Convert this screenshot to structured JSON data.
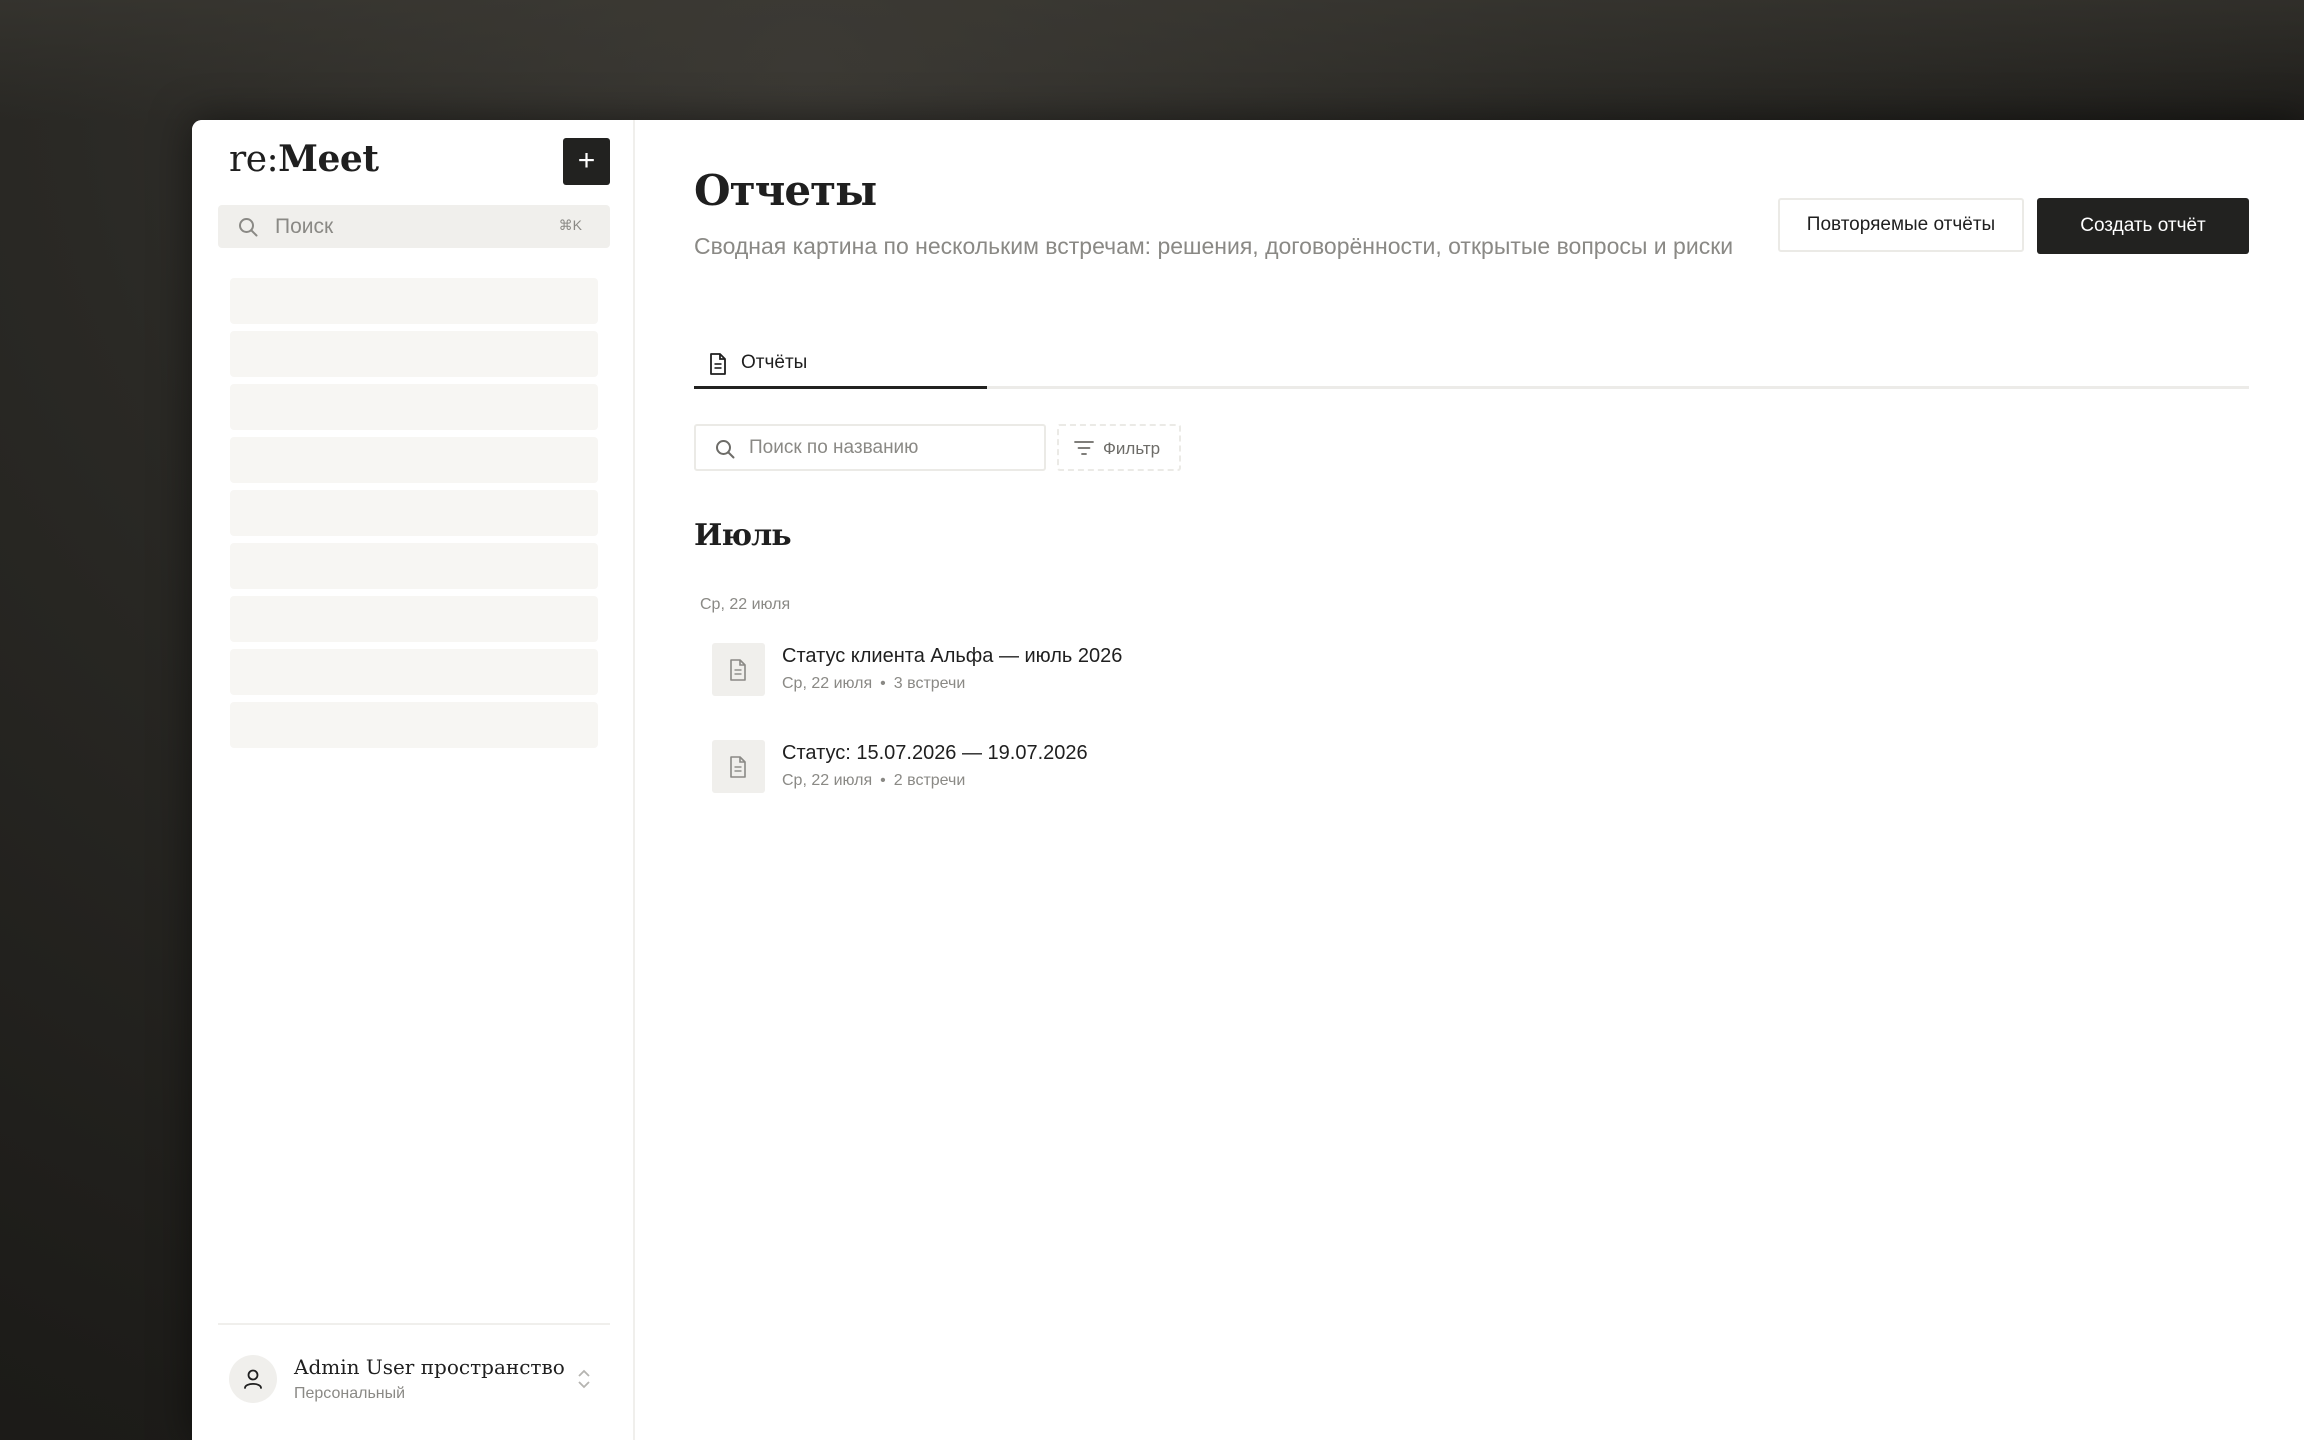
{
  "sidebar": {
    "logo_light": "re:",
    "logo_bold": "Meet",
    "new_button_label": "+",
    "search_placeholder": "Поиск",
    "search_shortcut": "⌘K",
    "workspace_name": "Admin User пространство",
    "workspace_type": "Персональный"
  },
  "header": {
    "title": "Отчеты",
    "description": "Сводная картина по нескольким встречам: решения, договорённости, открытые вопросы и риски",
    "recurring_button": "Повторяемые отчёты",
    "create_button": "Создать отчёт"
  },
  "tabs": [
    {
      "label": "Отчёты",
      "active": true
    }
  ],
  "toolbar": {
    "search_placeholder": "Поиск по названию",
    "filter_label": "Фильтр"
  },
  "groups": [
    {
      "month": "Июль",
      "days": [
        {
          "date": "Ср, 22 июля",
          "reports": [
            {
              "title": "Статус клиента Альфа — июль 2026",
              "date": "Ср, 22 июля",
              "meetings": "3 встречи"
            },
            {
              "title": "Статус: 15.07.2026 — 19.07.2026",
              "date": "Ср, 22 июля",
              "meetings": "2 встречи"
            }
          ]
        }
      ]
    }
  ],
  "meta_separator": "•",
  "icons": {
    "search": "search-icon",
    "document": "document-icon",
    "filter": "filter-icon",
    "user": "user-icon",
    "chevron": "chevron-up-down-icon"
  },
  "colors": {
    "accent_dark": "#222220",
    "muted_text": "#8a8985",
    "surface": "#f0efec"
  }
}
